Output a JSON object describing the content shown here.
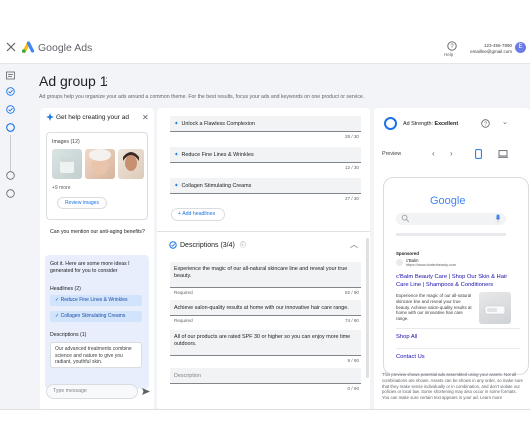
{
  "app": {
    "brand": "Google Ads",
    "account_id": "123-456-7890",
    "account_email": "emaillne@gmail.com",
    "avatar_letter": "E",
    "help_label": "Help"
  },
  "header": {
    "title": "Ad group 1",
    "subtitle": "Ad groups help you organize your ads around a common theme. For the best results, focus your ads and keywords on one product or service."
  },
  "assistant": {
    "title": "Get help creating your ad",
    "images_label": "Images (12)",
    "more_label": "+9 more",
    "review_button": "Review images",
    "question": "Can you mention our anti-aging benefits?",
    "reply_intro": "Got it. Here are some more ideas I generated for you to consider",
    "headlines_label": "Headlines (2)",
    "headline_chips": [
      "Reduce Fine Lines & Wrinkles",
      "Collagen Stimulating Creams"
    ],
    "descriptions_label": "Descriptions (1)",
    "description_suggestion": "Our advanced treatments combine science and nature to give you radiant, youthful skin.",
    "input_placeholder": "Type message"
  },
  "editor": {
    "headlines": [
      {
        "text": "Unlock a Flawless Complexion",
        "count": "28 / 30"
      },
      {
        "text": "Reduce Fine Lines & Wrinkles",
        "count": "12 / 30"
      },
      {
        "text": "Collagen Stimulating Creams",
        "count": "27 / 30"
      }
    ],
    "add_headlines": "Add headlines",
    "descriptions_title": "Descriptions (3/4)",
    "descriptions": [
      {
        "text": "Experience the magic of our all-natural skincare line and reveal your true beauty.",
        "required": "Required",
        "count": "82 / 90"
      },
      {
        "text": "Achieve salon-quality results at home with our innovative hair care range.",
        "required": "Required",
        "count": "74 / 90"
      },
      {
        "text": "All of our products are rated SPF 30 or higher so you can enjoy more time outdoors.",
        "required": "",
        "count": "9 / 90"
      }
    ],
    "empty_placeholder": "Description",
    "empty_count": "0 / 90"
  },
  "preview": {
    "strength_label": "Ad Strength:",
    "strength_value": "Excellent",
    "preview_label": "Preview",
    "google_logo": "Google",
    "sponsored": "Sponsored",
    "advertiser_name": "c'Balm",
    "advertiser_url": "https://www.cbalmbeauty.com",
    "ad_headline": "c'Balm Beauty Care | Shop Our Skin & Hair Care Line | Shampoos & Conditioners",
    "ad_description": "Experience the magic of our all-natural skincare line and reveal your true beauty. Achieve salon-quality results at home with our innovative hair care range.",
    "sitelinks": [
      "Shop All",
      "Contact Us"
    ],
    "note": "This preview shows potential ads assembled using your assets. Not all combinations are shown. Assets can be shown in any order, so make sure that they make sense individually or in combination, and don't violate our policies or local law. Some shortening may also occur in some formats. You can make sure certain text appears in your ad. Learn more"
  },
  "colors": {
    "accent": "#1a73e8",
    "link": "#1a0dab",
    "chip": "#d2e3fc"
  }
}
